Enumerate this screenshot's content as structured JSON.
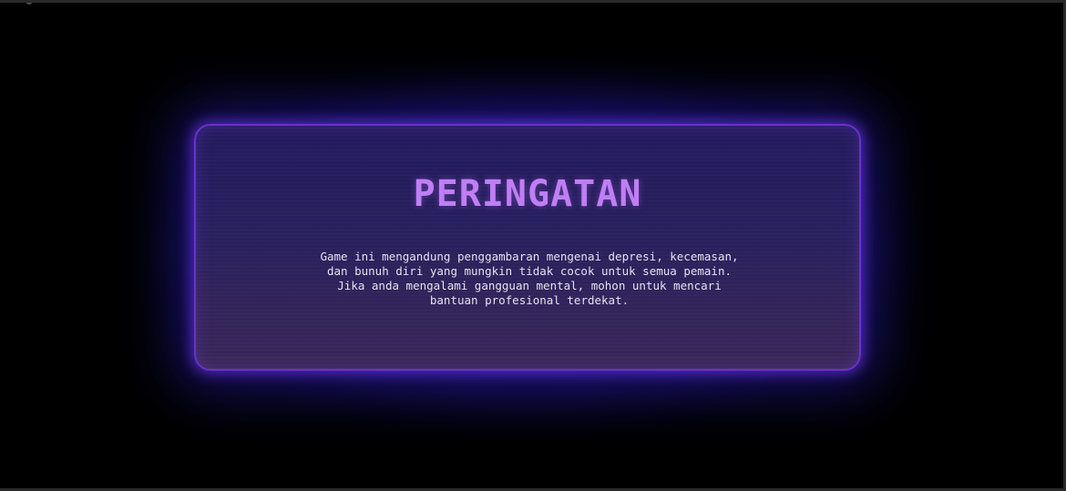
{
  "warning": {
    "title": "PERINGATAN",
    "body": "Game ini mengandung penggambaran mengenai depresi, kecemasan, dan bunuh diri yang mungkin tidak cocok untuk semua pemain. Jika anda mengalami gangguan mental, mohon untuk mencari bantuan profesional terdekat."
  },
  "colors": {
    "background": "#000000",
    "panel_top": "#231a5c",
    "panel_bottom": "#3a2757",
    "panel_border": "#6a32c8",
    "glow": "#3c28c8",
    "title": "#c07ef5",
    "body_text": "#e4e1ef"
  }
}
